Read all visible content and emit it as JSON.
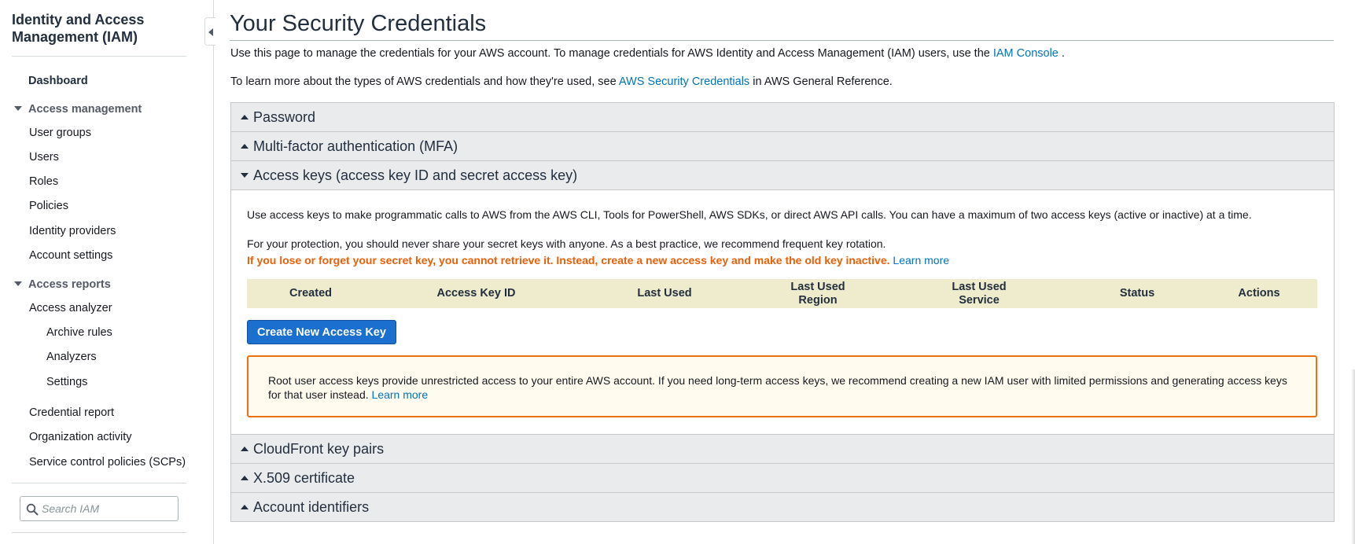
{
  "sidebar": {
    "title": "Identity and Access Management (IAM)",
    "dashboard": "Dashboard",
    "access_management": {
      "label": "Access management",
      "items": [
        "User groups",
        "Users",
        "Roles",
        "Policies",
        "Identity providers",
        "Account settings"
      ]
    },
    "access_reports": {
      "label": "Access reports",
      "analyzer": "Access analyzer",
      "analyzer_sub": [
        "Archive rules",
        "Analyzers",
        "Settings"
      ],
      "items": [
        "Credential report",
        "Organization activity",
        "Service control policies (SCPs)"
      ]
    },
    "search": {
      "placeholder": "Search IAM",
      "icon": "search-icon"
    }
  },
  "main": {
    "title": "Your Security Credentials",
    "intro1": {
      "text": "Use this page to manage the credentials for your AWS account. To manage credentials for AWS Identity and Access Management (IAM) users, use the ",
      "link": "IAM Console",
      "suffix": " ."
    },
    "intro2": {
      "text": "To learn more about the types of AWS credentials and how they're used, see ",
      "link": "AWS Security Credentials",
      "suffix": " in AWS General Reference."
    },
    "sections": {
      "password": "Password",
      "mfa": "Multi-factor authentication (MFA)",
      "access_keys": "Access keys (access key ID and secret access key)",
      "cloudfront": "CloudFront key pairs",
      "x509": "X.509 certificate",
      "account_ids": "Account identifiers"
    },
    "access_keys": {
      "desc": "Use access keys to make programmatic calls to AWS from the AWS CLI, Tools for PowerShell, AWS SDKs, or direct AWS API calls. You can have a maximum of two access keys (active or inactive) at a time.",
      "protection": "For your protection, you should never share your secret keys with anyone. As a best practice, we recommend frequent key rotation.",
      "warning": "If you lose or forget your secret key, you cannot retrieve it. Instead, create a new access key and make the old key inactive.",
      "learn_more": "Learn more",
      "table_headers": [
        "Created",
        "Access Key ID",
        "Last Used",
        "Last Used Region",
        "Last Used Service",
        "Status",
        "Actions"
      ],
      "create_button": "Create New Access Key",
      "root_notice": "Root user access keys provide unrestricted access to your entire AWS account. If you need long-term access keys, we recommend creating a new IAM user with limited permissions and generating access keys for that user instead.",
      "root_learn_more": "Learn more"
    }
  },
  "colors": {
    "link": "#0073bb",
    "warning_text": "#eb5f07",
    "primary_button": "#1a6fcf",
    "table_header_bg": "#efeccd",
    "notice_border": "#ec7211",
    "notice_bg": "#fffcef",
    "accordion_header_bg": "#e9ebed"
  }
}
